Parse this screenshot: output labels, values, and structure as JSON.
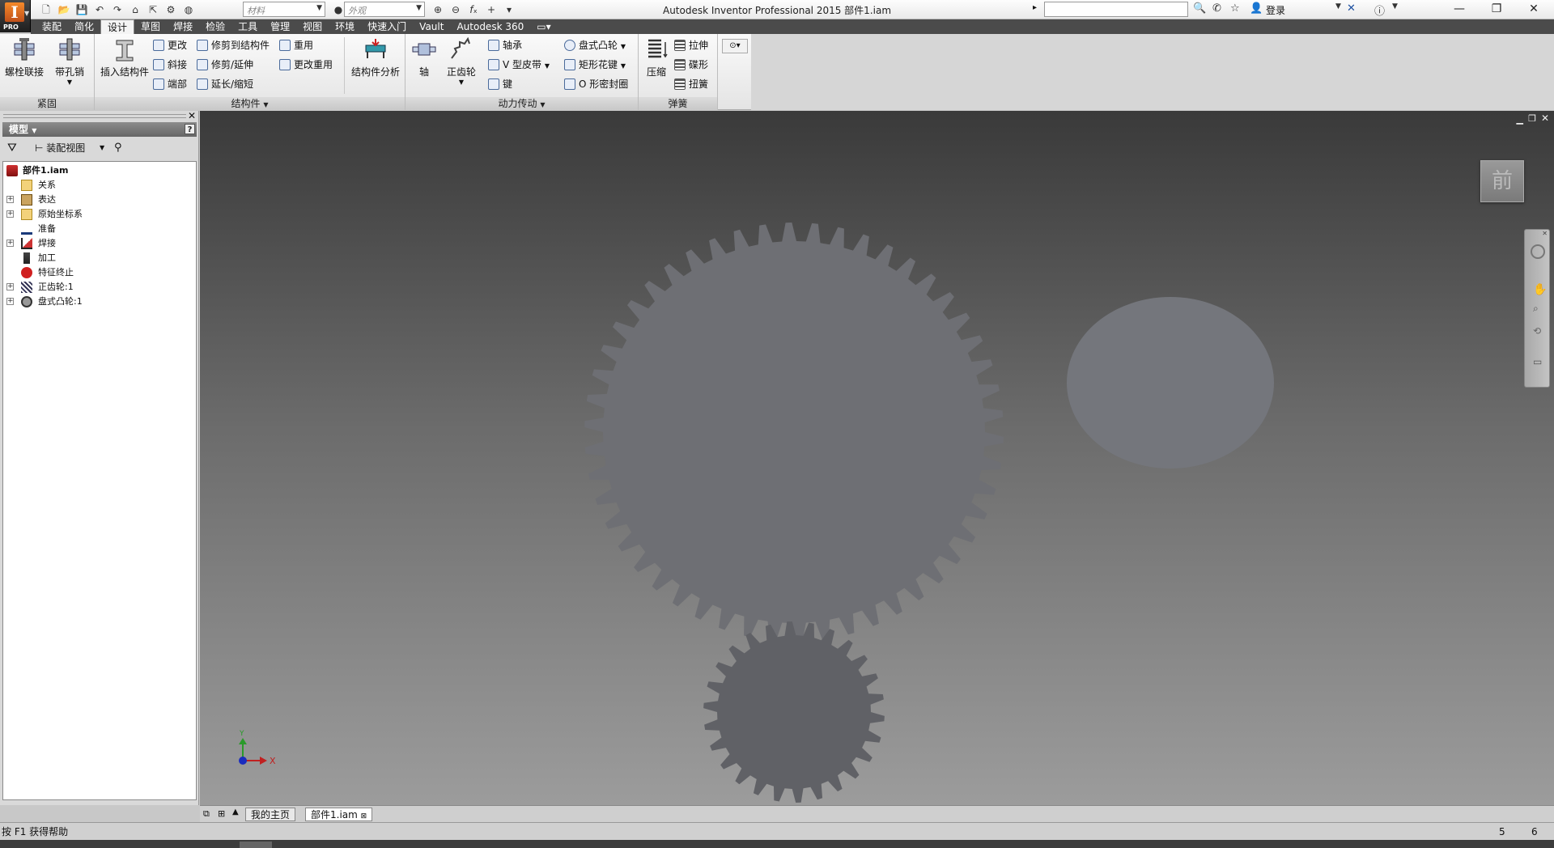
{
  "titlebar": {
    "app_logo": "I",
    "app_badge": "PRO",
    "window_title": "Autodesk Inventor Professional 2015    部件1.iam",
    "material_combo": "材料",
    "appearance_combo": "外观",
    "sign_in": "登录"
  },
  "tabs": [
    "装配",
    "简化",
    "设计",
    "草图",
    "焊接",
    "检验",
    "工具",
    "管理",
    "视图",
    "环境",
    "快速入门",
    "Vault",
    "Autodesk 360"
  ],
  "active_tab": "设计",
  "ribbon": {
    "fasten": {
      "label": "紧固",
      "bolted": "螺栓联接",
      "clevis_pin": "带孔销"
    },
    "frame": {
      "label": "结构件",
      "insert_frame": "插入结构件",
      "change": "更改",
      "miter": "斜接",
      "end_cap": "端部",
      "trim_to_frame": "修剪到结构件",
      "trim_extend": "修剪/延伸",
      "lengthen_shorten": "延长/缩短",
      "reuse": "重用",
      "change_reuse": "更改重用",
      "frame_analysis": "结构件分析"
    },
    "power_transmission": {
      "label": "动力传动",
      "shaft": "轴",
      "spur_gear": "正齿轮",
      "bearing": "轴承",
      "vbelts": "V 型皮带",
      "key": "键",
      "disc_cam": "盘式凸轮",
      "spline": "矩形花键",
      "oring": "O 形密封圈"
    },
    "spring": {
      "label": "弹簧",
      "compression": "压缩",
      "extension": "拉伸",
      "belleville": "碟形",
      "torsion": "扭簧"
    }
  },
  "browser": {
    "header": "模型",
    "view_mode": "装配视图",
    "tree": [
      {
        "label": "部件1.iam",
        "icon": "assembly-icon",
        "level": 0,
        "expander": ""
      },
      {
        "label": "关系",
        "icon": "folder-icon",
        "level": 1,
        "expander": ""
      },
      {
        "label": "表达",
        "icon": "representations-icon",
        "level": 1,
        "expander": "+"
      },
      {
        "label": "原始坐标系",
        "icon": "folder-icon",
        "level": 1,
        "expander": "+"
      },
      {
        "label": "准备",
        "icon": "preparations-icon",
        "level": 1,
        "expander": ""
      },
      {
        "label": "焊接",
        "icon": "welds-icon",
        "level": 1,
        "expander": "+"
      },
      {
        "label": "加工",
        "icon": "machining-icon",
        "level": 1,
        "expander": ""
      },
      {
        "label": "特征终止",
        "icon": "end-of-features-icon",
        "level": 1,
        "expander": ""
      },
      {
        "label": "正齿轮:1",
        "icon": "spur-gear-icon",
        "level": 1,
        "expander": "+"
      },
      {
        "label": "盘式凸轮:1",
        "icon": "disc-cam-icon",
        "level": 1,
        "expander": "+"
      }
    ]
  },
  "viewcube": {
    "face": "前"
  },
  "triad": {
    "x": "X",
    "y": "Y"
  },
  "doc_tabs": {
    "home": "我的主页",
    "document": "部件1.iam"
  },
  "status": {
    "help": "按 F1 获得帮助",
    "count1": "5",
    "count2": "6"
  },
  "colors": {
    "accent_orange": "#e06a1e",
    "tab_bar": "#4b4b4b",
    "gear": "#6e6f74",
    "viewport_top": "#3a3a3a",
    "viewport_bottom": "#9c9c9c"
  }
}
